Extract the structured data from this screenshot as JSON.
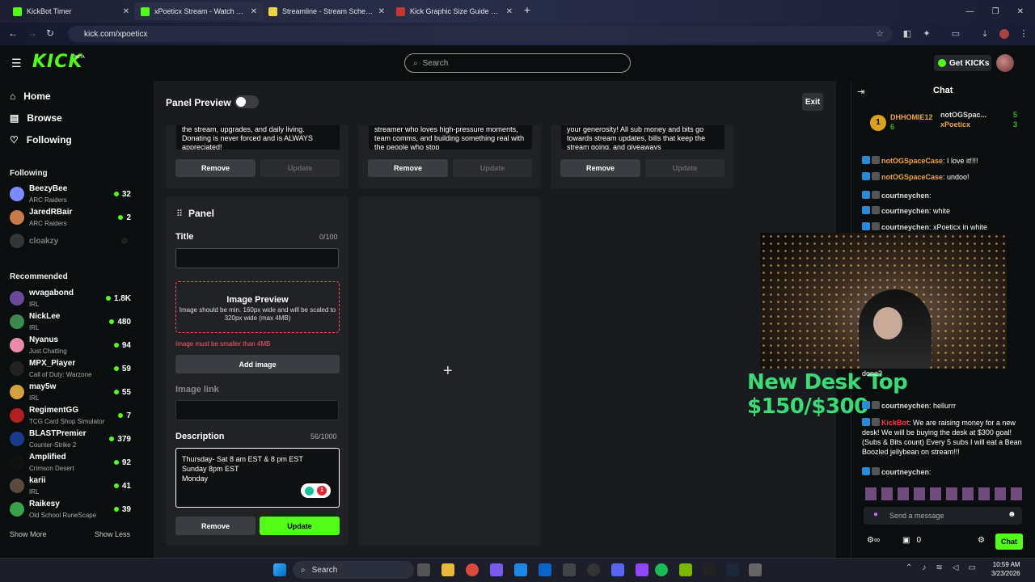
{
  "browser": {
    "tabs": [
      {
        "title": "KickBot Timer",
        "close": "✕"
      },
      {
        "title": "xPoeticx Stream - Watch Live on",
        "close": "✕"
      },
      {
        "title": "Streamline - Stream Schedule",
        "close": "✕"
      },
      {
        "title": "Kick Graphic Size Guide 2025 -",
        "close": "✕"
      }
    ],
    "url": "kick.com/xpoeticx"
  },
  "header": {
    "logo": "KICK",
    "beta": "BETA",
    "search_placeholder": "Search",
    "get_kicks": "Get KICKs"
  },
  "sidebar": {
    "nav": [
      {
        "label": "Home",
        "icon": "⌂"
      },
      {
        "label": "Browse",
        "icon": "▤"
      },
      {
        "label": "Following",
        "icon": "♡"
      }
    ],
    "following_title": "Following",
    "following": [
      {
        "name": "BeezyBee",
        "game": "ARC Raiders",
        "viewers": "32",
        "color": "#7a8cff"
      },
      {
        "name": "JaredRBair",
        "game": "ARC Raiders",
        "viewers": "2",
        "color": "#c97a4a"
      },
      {
        "name": "cloakzy",
        "game": "",
        "viewers": "",
        "color": "#666"
      }
    ],
    "recommended_title": "Recommended",
    "recommended": [
      {
        "name": "wvagabond",
        "game": "IRL",
        "viewers": "1.8K",
        "color": "#6a4a9a"
      },
      {
        "name": "NickLee",
        "game": "IRL",
        "viewers": "480",
        "color": "#3c8a4c"
      },
      {
        "name": "Nyanus",
        "game": "Just Chatting",
        "viewers": "94",
        "color": "#e88aa8"
      },
      {
        "name": "MPX_Player",
        "game": "Call of Duty: Warzone",
        "viewers": "59",
        "color": "#222"
      },
      {
        "name": "may5w",
        "game": "IRL",
        "viewers": "55",
        "color": "#d4a040"
      },
      {
        "name": "RegimentGG",
        "game": "TCG Card Shop Simulator",
        "viewers": "7",
        "color": "#b02020"
      },
      {
        "name": "BLASTPremier",
        "game": "Counter-Strike 2",
        "viewers": "379",
        "color": "#1a3a8a"
      },
      {
        "name": "Amplified",
        "game": "Crimson Desert",
        "viewers": "92",
        "color": "#111"
      },
      {
        "name": "karii",
        "game": "IRL",
        "viewers": "41",
        "color": "#5a4a40"
      },
      {
        "name": "Raikesy",
        "game": "Old School RuneScape",
        "viewers": "39",
        "color": "#3aa04a"
      }
    ],
    "show_more": "Show More",
    "show_less": "Show Less"
  },
  "main": {
    "title": "Panel Preview",
    "exit": "Exit",
    "existing_panels": [
      {
        "desc": "the stream, upgrades, and daily living. Donating is never forced and is ALWAYS appreciated!",
        "remove": "Remove",
        "update": "Update"
      },
      {
        "desc": "streamer who loves high-pressure moments, team comms, and building something real with the people who stop",
        "remove": "Remove",
        "update": "Update"
      },
      {
        "desc": "your generosity! All sub money and bits go towards stream updates, bills that keep the stream going, and giveaways",
        "remove": "Remove",
        "update": "Update"
      }
    ],
    "editor": {
      "heading": "Panel",
      "title_label": "Title",
      "title_count": "0/100",
      "title_value": "",
      "image_preview": "Image Preview",
      "image_hint": "Image should be min. 160px wide and will be scaled to 320px wide (max 4MB)",
      "image_error": "Image must be smaller than 4MB",
      "add_image": "Add image",
      "link_label": "Image link",
      "link_value": "",
      "desc_label": "Description",
      "desc_count": "56/1000",
      "desc_value": "Thursday- Sat 8 am EST & 8 pm EST\nSunday 8pm EST\nMonday",
      "grammar_count": "1",
      "remove": "Remove",
      "update": "Update"
    },
    "add_symbol": "+"
  },
  "chat": {
    "title": "Chat",
    "top": [
      {
        "name": "DHHOMIE12",
        "count": "6"
      },
      {
        "name": "notOGSpac...",
        "count": "5"
      },
      {
        "name": "xPoeticx",
        "count": "3"
      }
    ],
    "messages": [
      {
        "user": "notOGSpaceCase",
        "text": ": I love it!!!!",
        "color": "u-or"
      },
      {
        "user": "notOGSpaceCase",
        "text": ": undoo!",
        "color": "u-or"
      },
      {
        "user": "courtneychen",
        "text": ":",
        "color": "u-wh"
      },
      {
        "user": "courtneychen",
        "text": ": white",
        "color": "u-wh"
      },
      {
        "user": "courtneychen",
        "text": ": xPoeticx in white",
        "color": "u-wh"
      }
    ],
    "messages_bottom": [
      {
        "user": "",
        "text": "done?",
        "color": "u-wh"
      },
      {
        "user": "courtneychen",
        "text": ": hellurrr",
        "color": "u-wh"
      },
      {
        "user": "KickBot",
        "text": ": We are raising money for a new desk! We will be buying the desk at $300 goal! (Subs & Bits count) Every 5 subs I will eat a Bean Boozled jellybean on stream!!!",
        "color": "u-rd"
      },
      {
        "user": "courtneychen",
        "text": ":",
        "color": "u-wh"
      }
    ],
    "overlay": "New Desk Top $150/$300",
    "send_placeholder": "Send a message",
    "kicks_count": "0",
    "chat_button": "Chat"
  },
  "taskbar": {
    "search": "Search",
    "time": "10:59 AM",
    "date": "3/23/2026"
  }
}
